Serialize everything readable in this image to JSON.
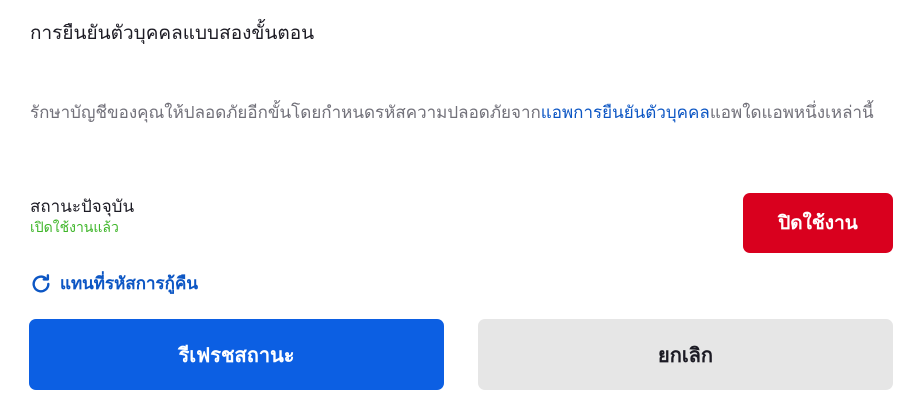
{
  "dialog": {
    "title": "การยืนยันตัวบุคคลแบบสองขั้นตอน",
    "description": {
      "before_link": "รักษาบัญชีของคุณให้ปลอดภัยอีกขั้นโดยกำหนดรหัสความปลอดภัยจาก",
      "link_text": "แอพการยืนยันตัวบุคคล",
      "after_link": "แอพใดแอพหนึ่งเหล่านี้"
    },
    "status": {
      "label": "สถานะปัจจุบัน",
      "value": "เปิดใช้งานแล้ว",
      "value_color": "#3fb62a"
    },
    "disable_button": "ปิดใช้งาน",
    "replace_codes_link": {
      "icon": "refresh-icon",
      "label": "แทนที่รหัสการกู้คืน"
    },
    "refresh_button": "รีเฟรชสถานะ",
    "cancel_button": "ยกเลิก"
  },
  "colors": {
    "accent_blue": "#0c5fe3",
    "link_blue": "#0c56c4",
    "danger_red": "#d9001e",
    "secondary_gray": "#e6e6e6"
  }
}
